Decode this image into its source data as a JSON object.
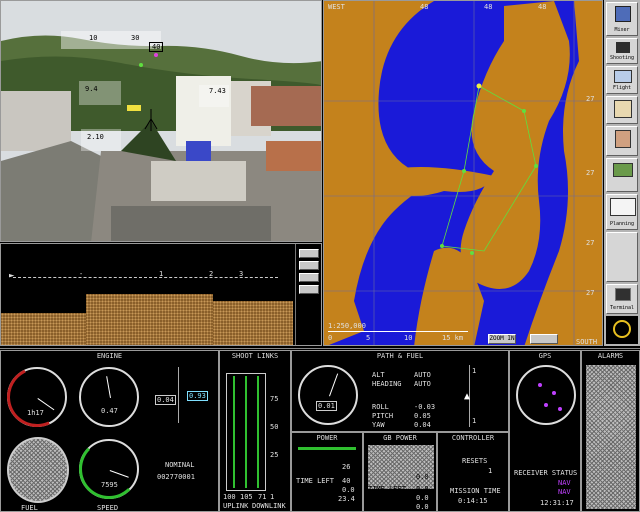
{
  "map": {
    "top_left_label": "WEST",
    "top_ticks": [
      "48",
      "48",
      "48"
    ],
    "right_ticks": [
      "27",
      "27",
      "27",
      "27"
    ],
    "scale": "1:250,000",
    "scale_ticks": [
      "0",
      "5",
      "10",
      "15 km"
    ],
    "bottom_right_label": "SOUTH",
    "zoom_button": "ZOOM IN",
    "colors": {
      "water": "#1a1ad8",
      "land": "#c4821c"
    }
  },
  "video": {
    "overlay": [
      "10",
      "30",
      "40",
      "9.4",
      "7.43",
      "2.10"
    ]
  },
  "profile": {
    "ticks": [
      "-",
      "1",
      "2",
      "3"
    ],
    "side_buttons": [
      "",
      "",
      "",
      ""
    ]
  },
  "sidebar": {
    "items": [
      "Mixer",
      "Shooting",
      "Flight",
      "",
      "Planning",
      "",
      "Terminal",
      ""
    ]
  },
  "engine": {
    "title": "ENGINE",
    "gauge1_value": "1h17",
    "gauge2_value": "0.47",
    "throttle_left": "0.04",
    "throttle_right": "0.93",
    "gauge3_value": "7595",
    "gauge3_label": "SPEED",
    "mode": "NOMINAL",
    "counter": "002770001",
    "fuel_label": "FUEL"
  },
  "shoot": {
    "title": "SHOOT LINKS",
    "scale": [
      "75",
      "50",
      "25"
    ],
    "bottom": [
      "100",
      "105",
      "71",
      "1"
    ],
    "bottom2": [
      "UPLINK",
      "DOWNLINK"
    ]
  },
  "flight": {
    "title": "PATH & FUEL",
    "value": "0.01",
    "auto1_k": "ALT",
    "auto1_v": "AUTO",
    "auto2_k": "HEADING",
    "auto2_v": "AUTO",
    "rows": [
      [
        "ROLL",
        "-0.03"
      ],
      [
        "PITCH",
        "0.05"
      ],
      [
        "YAW",
        "0.04"
      ]
    ],
    "tick_top": "1",
    "tick_bot": "1"
  },
  "gps": {
    "title": "GPS",
    "status_title": "RECEIVER STATUS",
    "status_rows": [
      [
        "",
        "NAV"
      ],
      [
        "",
        "NAV"
      ]
    ],
    "time": "12:31:17"
  },
  "alarms": {
    "title": "ALARMS"
  },
  "power": {
    "title": "POWER",
    "rows": [
      [
        "",
        "26"
      ],
      [
        "TIME LEFT",
        "40"
      ],
      [
        "",
        "0.0"
      ],
      [
        "",
        "23.4"
      ]
    ]
  },
  "gb_power": {
    "title": "GB POWER",
    "rows": [
      [
        "",
        "0.0"
      ],
      [
        "TIME LEFT",
        "0.0"
      ],
      [
        "",
        "0.0"
      ],
      [
        "",
        "0.0"
      ]
    ]
  },
  "controller": {
    "title": "CONTROLLER",
    "resets": "RESETS",
    "resets_v": "1",
    "mission": "MISSION TIME",
    "mission_v": "0:14:15"
  }
}
